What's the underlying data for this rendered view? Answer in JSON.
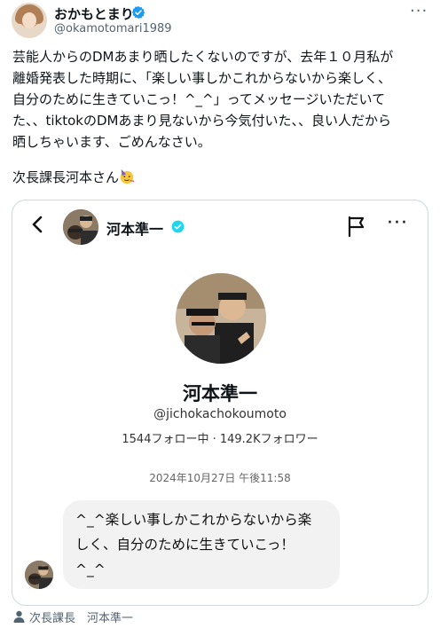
{
  "header": {
    "display_name": "おかもとまり",
    "handle": "@okamotomari1989",
    "more": "···"
  },
  "tweet": {
    "body": "芸能人からのDMあまり晒したくないのですが、去年１０月私が\n離婚発表した時期に、「楽しい事しかこれからないから楽しく、\n自分のために生きていこっ！^_^」ってメッセージいただいて\nた、、tiktokのDMあまり見ないから今気付いた、、良い人だから\n晒しちゃいます、ごめんなさい。",
    "closing": "次長課長河本さん"
  },
  "screenshot": {
    "header_name": "河本準一",
    "profile_name": "河本準一",
    "profile_handle": "@jichokachokoumoto",
    "stats": "1544フォロー中 · 149.2Kフォロワー",
    "timestamp": "2024年10月27日 午後11:58",
    "message": "^_^楽しい事しかこれからないから楽\nしく、自分のために生きていこっ！\n^_^"
  },
  "footer": {
    "tagged": "次長課長　河本準一"
  },
  "colors": {
    "verified": "#1d9bf0",
    "secondary_text": "#536471"
  }
}
